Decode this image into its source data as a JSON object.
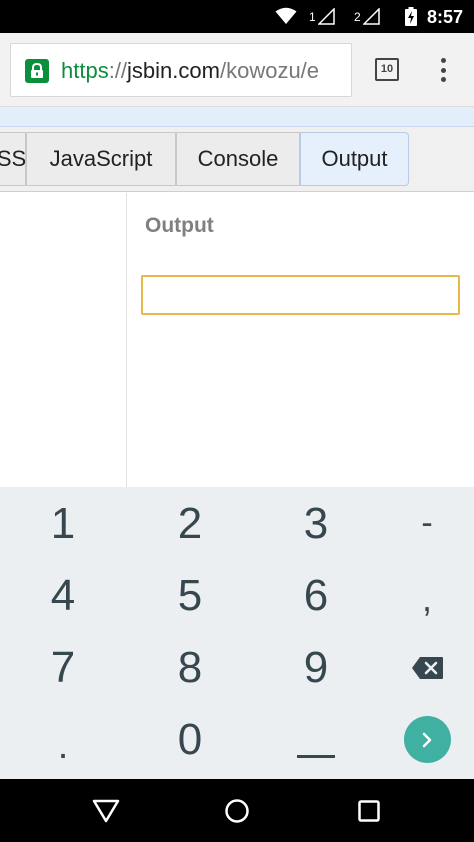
{
  "status_bar": {
    "time": "8:57",
    "sim1_label": "1",
    "sim2_label": "2",
    "icons": [
      "wifi-icon",
      "signal-icon",
      "signal-icon",
      "battery-charging-icon"
    ]
  },
  "browser": {
    "url_scheme": "https",
    "url_separator": "://",
    "url_host": "jsbin.com",
    "url_path": "/kowozu/e",
    "tab_count": "10",
    "secure_color": "#0b8f3c"
  },
  "panel_tabs": [
    {
      "label": "CSS"
    },
    {
      "label": "JavaScript"
    },
    {
      "label": "Console"
    },
    {
      "label": "Output",
      "active": true
    }
  ],
  "output_panel": {
    "heading": "Output",
    "input_value": ""
  },
  "keyboard": {
    "rows": [
      [
        "1",
        "2",
        "3",
        "-"
      ],
      [
        "4",
        "5",
        "6",
        ","
      ],
      [
        "7",
        "8",
        "9",
        "backspace"
      ],
      [
        ".",
        "0",
        "space",
        "go"
      ]
    ],
    "accent_color": "#3fb0a2"
  },
  "nav_bar": {
    "icons": [
      "back-icon",
      "home-icon",
      "recents-icon"
    ]
  }
}
